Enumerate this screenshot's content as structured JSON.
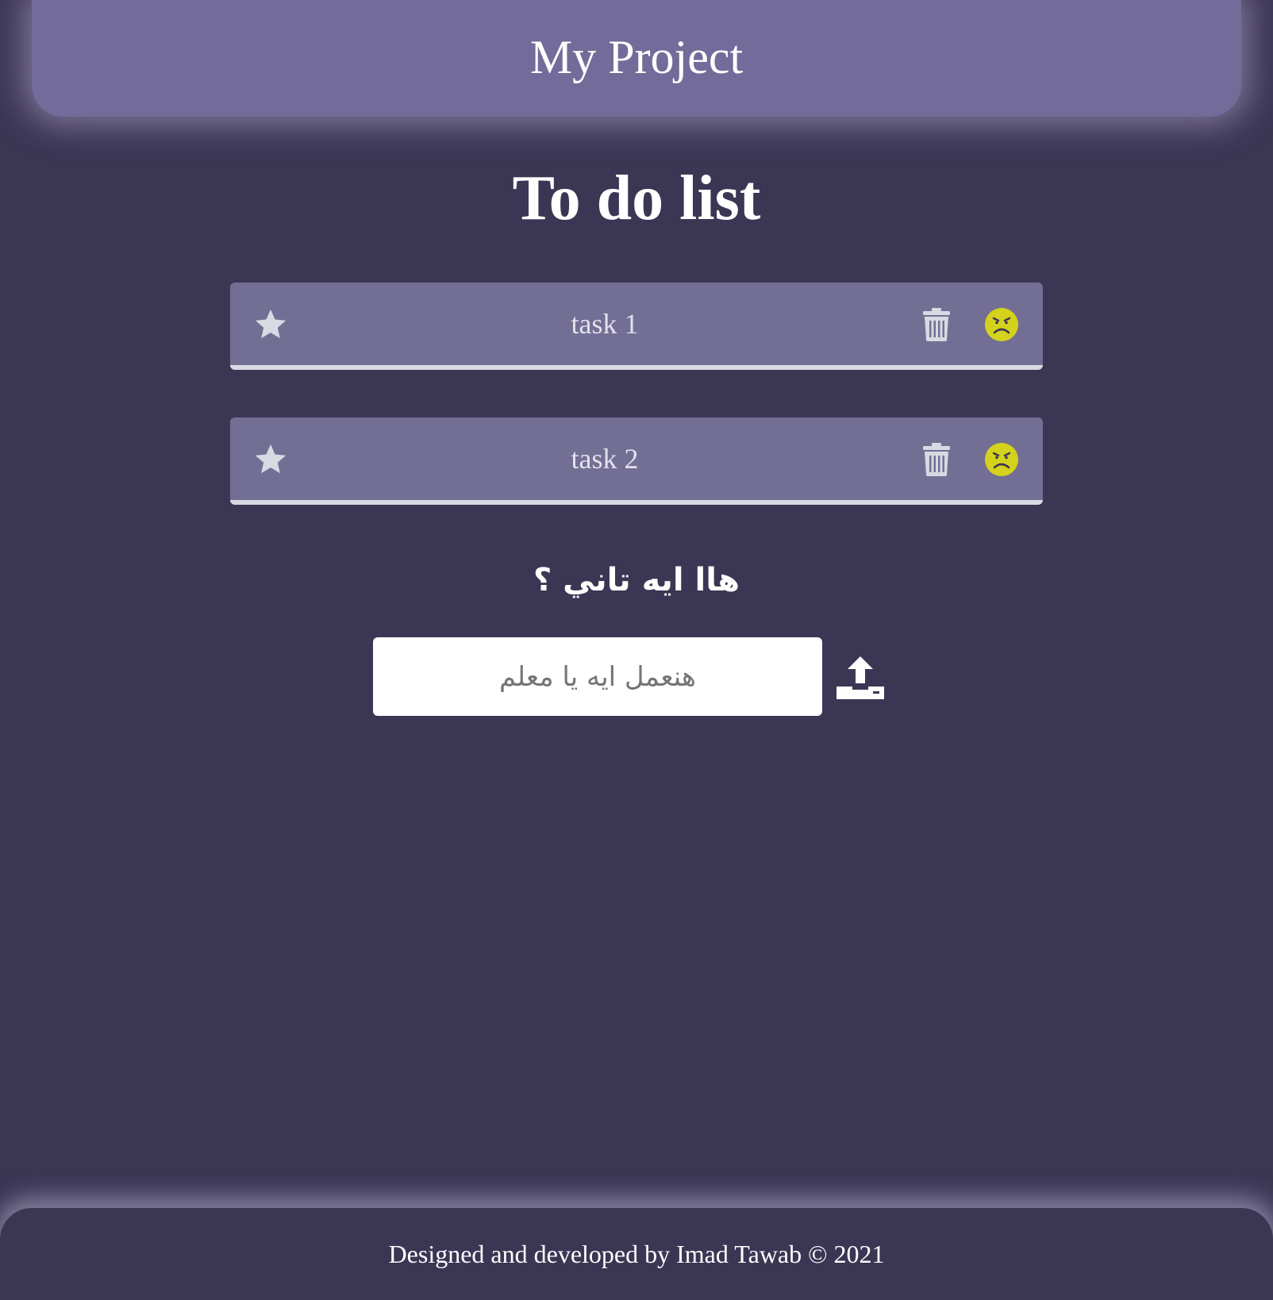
{
  "header": {
    "title": "My Project"
  },
  "main": {
    "title": "To do list",
    "tasks": [
      {
        "label": "task 1",
        "star_icon": "star-icon",
        "delete_icon": "trash-icon",
        "status_icon": "angry-face-icon"
      },
      {
        "label": "task 2",
        "star_icon": "star-icon",
        "delete_icon": "trash-icon",
        "status_icon": "angry-face-icon"
      }
    ],
    "question": "هاا ايه تاني ؟",
    "input": {
      "value": "",
      "placeholder": "هنعمل ايه يا معلم"
    },
    "submit_icon": "upload-icon"
  },
  "footer": {
    "text": "Designed and developed by Imad Tawab © 2021"
  },
  "colors": {
    "background": "#3c3655",
    "header": "#736b99",
    "task_card": "#736f94",
    "icon_gray": "#d9d9e3",
    "face_yellow": "#d4d21c"
  }
}
